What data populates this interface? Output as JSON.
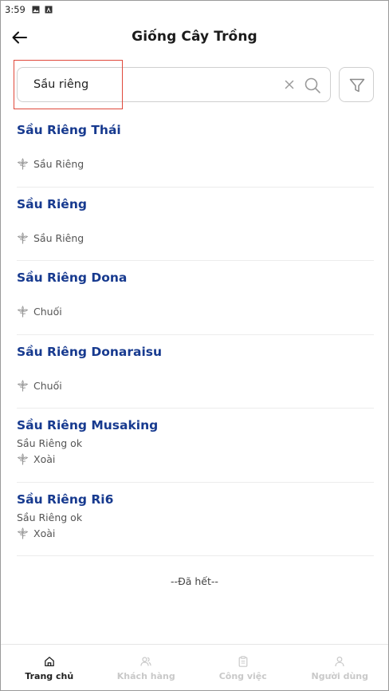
{
  "status_bar": {
    "time": "3:59"
  },
  "header": {
    "title": "Giống Cây Trồng"
  },
  "search": {
    "value": "Sầu riêng"
  },
  "results": [
    {
      "name": "Sầu Riêng Thái",
      "description": "",
      "category": "Sầu Riêng"
    },
    {
      "name": "Sầu Riêng",
      "description": "",
      "category": "Sầu Riêng"
    },
    {
      "name": "Sầu Riêng Dona",
      "description": "",
      "category": "Chuối"
    },
    {
      "name": "Sầu Riêng Donaraisu",
      "description": "",
      "category": "Chuối"
    },
    {
      "name": "Sầu Riêng Musaking",
      "description": "Sầu Riêng ok",
      "category": "Xoài"
    },
    {
      "name": "Sầu Riêng Ri6",
      "description": "Sầu Riêng ok",
      "category": "Xoài"
    }
  ],
  "list_end": "--Đã hết--",
  "bottom_nav": [
    {
      "label": "Trang chủ",
      "icon": "home-icon",
      "active": true
    },
    {
      "label": "Khách hàng",
      "icon": "customers-icon",
      "active": false
    },
    {
      "label": "Công việc",
      "icon": "clipboard-icon",
      "active": false
    },
    {
      "label": "Người dùng",
      "icon": "user-icon",
      "active": false
    }
  ],
  "colors": {
    "title_blue": "#173a8f",
    "highlight_red": "#e0483b",
    "border_gray": "#cfcfcf",
    "nav_inactive": "#c9c9c9"
  }
}
